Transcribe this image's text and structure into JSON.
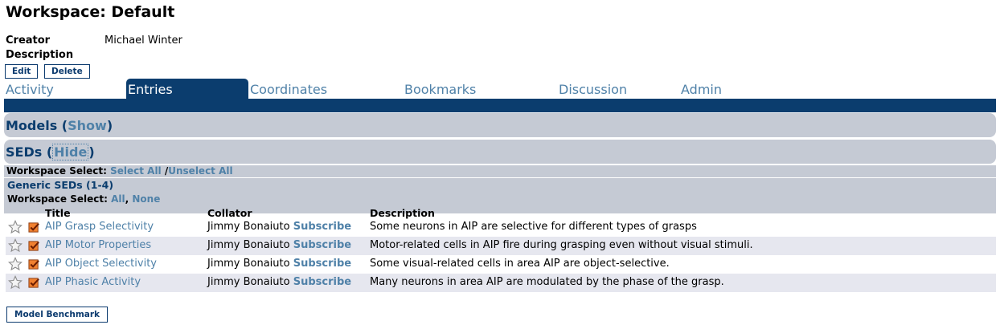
{
  "page": {
    "title": "Workspace: Default",
    "creator_label": "Creator",
    "creator_value": "Michael Winter",
    "description_label": "Description"
  },
  "actions": {
    "edit": "Edit",
    "delete": "Delete",
    "model_benchmark": "Model Benchmark"
  },
  "tabs": [
    {
      "label": "Activity",
      "active": false
    },
    {
      "label": "Entries",
      "active": true
    },
    {
      "label": "Coordinates",
      "active": false
    },
    {
      "label": "Bookmarks",
      "active": false
    },
    {
      "label": "Discussion",
      "active": false
    },
    {
      "label": "Admin",
      "active": false
    }
  ],
  "sections": {
    "models": {
      "label": "Models",
      "toggle": "Show"
    },
    "seds": {
      "label": "SEDs",
      "toggle": "Hide"
    }
  },
  "workspace_select": {
    "label": "Workspace Select:",
    "select_all": "Select All",
    "separator": "/",
    "unselect_all": "Unselect All"
  },
  "generic_seds": {
    "title": "Generic SEDs (1-4)",
    "ws_label": "Workspace Select:",
    "all": "All",
    "sep": ",",
    "none": "None",
    "columns": [
      "Title",
      "Collator",
      "Description"
    ],
    "rows": [
      {
        "title": "AIP Grasp Selectivity",
        "collator": "Jimmy Bonaiuto",
        "subscribe": "Subscribe",
        "description": "Some neurons in AIP are selective for different types of grasps"
      },
      {
        "title": "AIP Motor Properties",
        "collator": "Jimmy Bonaiuto",
        "subscribe": "Subscribe",
        "description": "Motor-related cells in AIP fire during grasping even without visual stimuli."
      },
      {
        "title": "AIP Object Selectivity",
        "collator": "Jimmy Bonaiuto",
        "subscribe": "Subscribe",
        "description": "Some visual-related cells in area AIP are object-selective."
      },
      {
        "title": "AIP Phasic Activity",
        "collator": "Jimmy Bonaiuto",
        "subscribe": "Subscribe",
        "description": "Many neurons in area AIP are modulated by the phase of the grasp."
      }
    ]
  },
  "colors": {
    "primary": "#0b3d6e",
    "link": "#4f81a8",
    "panel": "#c5cad4",
    "alt_row": "#e6e7ef"
  },
  "icons": {
    "star": "star-outline-icon",
    "checked": "checked-box-icon"
  }
}
